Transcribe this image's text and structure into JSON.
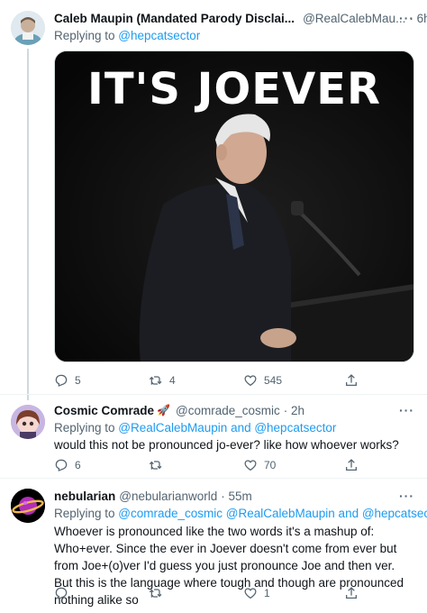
{
  "tweets": [
    {
      "name": "Caleb Maupin (Mandated Parody Disclai...",
      "handle": "@RealCalebMau...",
      "time": "· 6h",
      "reply_prefix": "Replying to ",
      "reply_mentions": "@hepcatsector",
      "media_text": "IT'S JOEVER",
      "actions": {
        "replies": "5",
        "retweets": "4",
        "likes": "545"
      }
    },
    {
      "name": "Cosmic Comrade",
      "emoji": "🚀",
      "handle": "@comrade_cosmic",
      "time": "· 2h",
      "reply_prefix": "Replying to ",
      "reply_mentions": "@RealCalebMaupin and @hepcatsector",
      "text": "would this not be pronounced jo-ever? like how whoever works?",
      "actions": {
        "replies": "6",
        "retweets": "",
        "likes": "70"
      }
    },
    {
      "name": "nebularian",
      "handle": "@nebularianworld",
      "time": "· 55m",
      "reply_prefix": "Replying to ",
      "reply_mentions": "@comrade_cosmic @RealCalebMaupin and @hepcatsector",
      "text": "Whoever is pronounced like the two words it's a mashup of: Who+ever. Since the ever in Joever doesn't come from ever but from Joe+(o)ver I'd guess you just pronounce Joe and then ver. But this is the language where tough and though are pronounced nothing alike so",
      "actions": {
        "replies": "",
        "retweets": "",
        "likes": "1"
      }
    }
  ],
  "more_glyph": "···",
  "icons": [
    "reply-icon",
    "retweet-icon",
    "like-icon",
    "share-icon",
    "more-icon"
  ],
  "colors": {
    "link": "#1d9bf0",
    "muted": "#536471",
    "text": "#0f1419",
    "line": "#cfd9de",
    "divider": "#eff3f4"
  }
}
